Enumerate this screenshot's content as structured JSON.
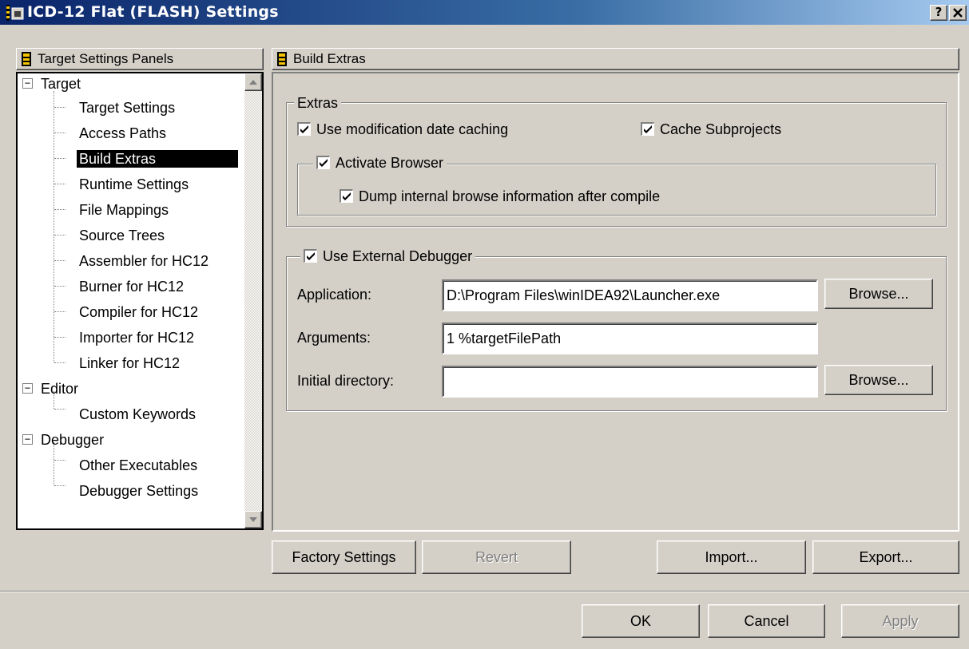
{
  "window": {
    "title": "ICD-12 Flat (FLASH) Settings",
    "help_label": "?",
    "close_label": "×"
  },
  "left_panel": {
    "header": "Target Settings Panels",
    "tree": [
      {
        "label": "Target",
        "level": 0,
        "expanded": true
      },
      {
        "label": "Target Settings",
        "level": 1
      },
      {
        "label": "Access Paths",
        "level": 1
      },
      {
        "label": "Build Extras",
        "level": 1,
        "selected": true
      },
      {
        "label": "Runtime Settings",
        "level": 1
      },
      {
        "label": "File Mappings",
        "level": 1
      },
      {
        "label": "Source Trees",
        "level": 1
      },
      {
        "label": "Assembler for HC12",
        "level": 1
      },
      {
        "label": "Burner for HC12",
        "level": 1
      },
      {
        "label": "Compiler for HC12",
        "level": 1
      },
      {
        "label": "Importer for HC12",
        "level": 1
      },
      {
        "label": "Linker for HC12",
        "level": 1
      },
      {
        "label": "Editor",
        "level": 0,
        "expanded": true
      },
      {
        "label": "Custom Keywords",
        "level": 1
      },
      {
        "label": "Debugger",
        "level": 0,
        "expanded": true
      },
      {
        "label": "Other Executables",
        "level": 1
      },
      {
        "label": "Debugger Settings",
        "level": 1
      }
    ]
  },
  "right_panel": {
    "header": "Build Extras",
    "extras": {
      "legend": "Extras",
      "use_mod_date_caching": {
        "label": "Use modification date caching",
        "checked": true
      },
      "cache_subprojects": {
        "label": "Cache Subprojects",
        "checked": true
      },
      "activate_browser": {
        "label": "Activate Browser",
        "checked": true
      },
      "dump_browse_info": {
        "label": "Dump internal browse information after compile",
        "checked": true
      }
    },
    "external_debugger": {
      "legend": "Use External Debugger",
      "checked": true,
      "application_label": "Application:",
      "application_value": "D:\\Program Files\\winIDEA92\\Launcher.exe",
      "arguments_label": "Arguments:",
      "arguments_value": "1 %targetFilePath",
      "initial_dir_label": "Initial directory:",
      "initial_dir_value": "",
      "browse_label": "Browse..."
    }
  },
  "buttons": {
    "factory_settings": "Factory Settings",
    "revert": "Revert",
    "import": "Import...",
    "export": "Export...",
    "ok": "OK",
    "cancel": "Cancel",
    "apply": "Apply"
  },
  "colors": {
    "face": "#d4d0c8",
    "title_start": "#0a246a",
    "title_end": "#a6caf0",
    "selection": "#000000"
  }
}
